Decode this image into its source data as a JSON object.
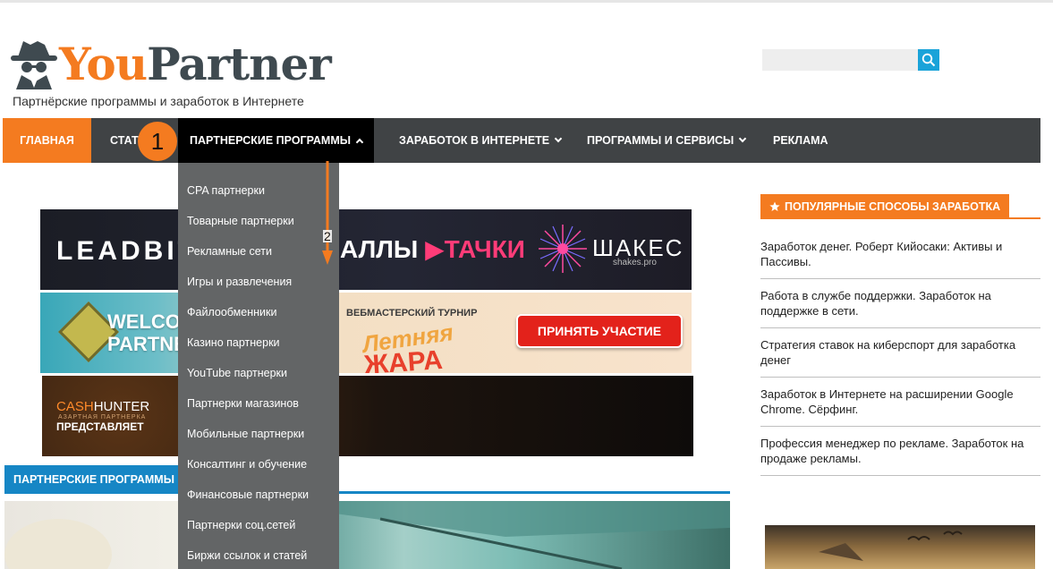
{
  "header": {
    "logo_you": "You",
    "logo_partner": "Partner",
    "tagline": "Партнёрские программы и заработок в Интернете"
  },
  "search": {
    "placeholder": "",
    "icon": "search-icon"
  },
  "nav": {
    "items": [
      {
        "label": "ГЛАВНАЯ",
        "active": true
      },
      {
        "label": "СТАТ"
      },
      {
        "label": "ПАРТНЕРСКИЕ ПРОГРАММЫ",
        "open": true
      },
      {
        "label": "ЗАРАБОТОК В ИНТЕРНЕТЕ"
      },
      {
        "label": "ПРОГРАММЫ И СЕРВИСЫ"
      },
      {
        "label": "РЕКЛАМА"
      }
    ]
  },
  "annotations": {
    "marker_1": "1",
    "marker_2": "2"
  },
  "dropdown": {
    "items": [
      "CPA партнерки",
      "Товарные партнерки",
      "Рекламные сети",
      "Игры и развлечения",
      "Файлообменники",
      "Казино партнерки",
      "YouTube партнерки",
      "Партнерки магазинов",
      "Мобильные партнерки",
      "Консалтинг и обучение",
      "Финансовые партнерки",
      "Партнерки соц.сетей",
      "Биржи ссылок и статей"
    ]
  },
  "banners": {
    "b1": {
      "lead": "LEADBIT",
      "mid_prefix": "АЛЛЫ",
      "mid_brand": "ТАЧКИ",
      "shakes": "ШАКЕС",
      "shakes_sub": "shakes.pro"
    },
    "b2": {
      "welcome_1": "WELCOM",
      "welcome_2": "PARTNER",
      "tournament": "ВЕБМАСТЕРСКИЙ ТУРНИР",
      "summer": "Летняя",
      "heat": "ЖАРА",
      "button": "ПРИНЯТЬ УЧАСТИЕ"
    },
    "b3": {
      "cash_1": "CASH",
      "cash_2": "HUNTER",
      "sub": "АЗАРТНАЯ ПАРТНЕРКА",
      "presents": "ПРЕДСТАВЛЯЕТ"
    }
  },
  "main": {
    "section_title": "ПАРТНЕРСКИЕ ПРОГРАММЫ"
  },
  "sidebar": {
    "title": "ПОПУЛЯРНЫЕ СПОСОБЫ ЗАРАБОТКА",
    "title_icon": "star-icon",
    "links": [
      "Заработок денег. Роберт Кийосаки: Активы и Пассивы.",
      "Работа в службе поддержки. Заработок на поддержке в сети.",
      "Стратегия ставок на киберспорт для заработка денег",
      "Заработок в Интернете на расширении Google Chrome. Сёрфинг.",
      "Профессия менеджер по рекламе. Заработок на продаже рекламы."
    ]
  },
  "colors": {
    "orange": "#f47b20",
    "nav_bg": "#404345",
    "blue": "#1686c5",
    "dropdown_bg": "#636566"
  }
}
